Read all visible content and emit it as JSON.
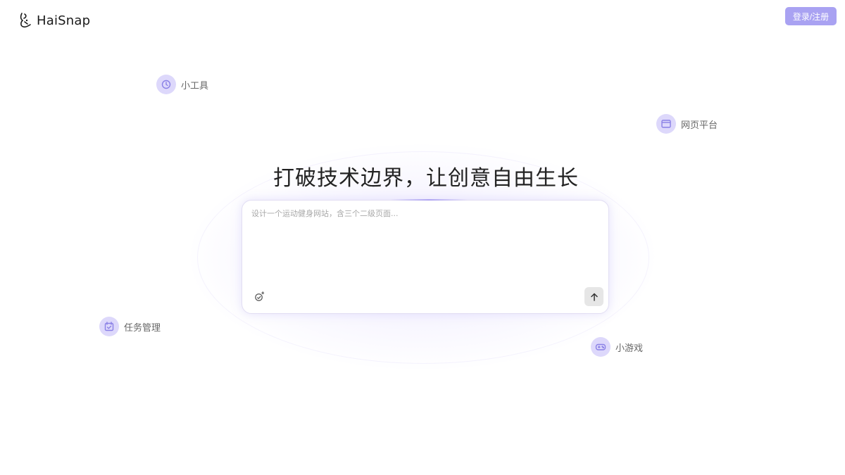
{
  "brand": {
    "name": "HaiSnap"
  },
  "header": {
    "login_label": "登录/注册"
  },
  "categories": [
    {
      "label": "小工具",
      "icon": "clock-icon"
    },
    {
      "label": "网页平台",
      "icon": "browser-window-icon"
    },
    {
      "label": "任务管理",
      "icon": "calendar-check-icon"
    },
    {
      "label": "小游戏",
      "icon": "gamepad-icon"
    }
  ],
  "hero": {
    "title": "打破技术边界，让创意自由生长"
  },
  "prompt": {
    "placeholder": "设计一个运动健身网站，含三个二级页面...",
    "value": ""
  },
  "colors": {
    "accent": "#a9a2f2",
    "chip_bg": "#ddd8fb",
    "icon_stroke": "#8a80e6",
    "send_bg": "#e6e6e6"
  }
}
